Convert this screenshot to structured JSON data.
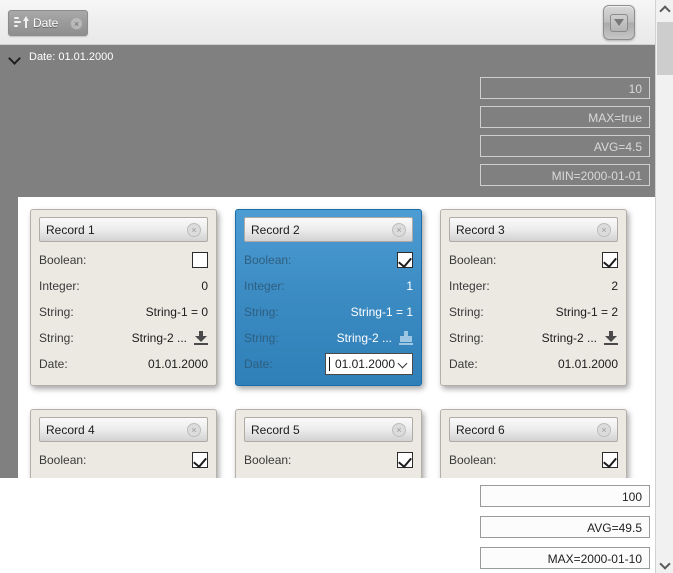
{
  "toolbar": {
    "sort_chip_label": "Date",
    "sort_chip_close": "×",
    "sort_icon": "sort-ascending-icon",
    "filter_button_icon": "filter-dropdown-icon"
  },
  "group": {
    "label": "Date: 01.01.2000",
    "expander_icon": "chevron-down-icon"
  },
  "aggregates_top": [
    {
      "value": "10"
    },
    {
      "value": "MAX=true"
    },
    {
      "value": "AVG=4.5"
    },
    {
      "value": "MIN=2000-01-01"
    }
  ],
  "aggregates_bottom": [
    {
      "value": "100"
    },
    {
      "value": "AVG=49.5"
    },
    {
      "value": "MAX=2000-01-10"
    }
  ],
  "field_labels": {
    "boolean": "Boolean:",
    "integer": "Integer:",
    "string1": "String:",
    "string2": "String:",
    "date": "Date:"
  },
  "cards": [
    {
      "title": "Record 1",
      "close": "×",
      "boolean": false,
      "integer": "0",
      "string1": "String-1 = 0",
      "string2": "String-2 ...",
      "date": "01.01.2000",
      "selected": false,
      "truncated": false
    },
    {
      "title": "Record 2",
      "close": "×",
      "boolean": true,
      "integer": "1",
      "string1": "String-1 = 1",
      "string2": "String-2 ...",
      "date": "01.01.2000",
      "selected": true,
      "truncated": false,
      "date_editing": true
    },
    {
      "title": "Record 3",
      "close": "×",
      "boolean": true,
      "integer": "2",
      "string1": "String-1 = 2",
      "string2": "String-2 ...",
      "date": "01.01.2000",
      "selected": false,
      "truncated": false
    },
    {
      "title": "Record 4",
      "close": "×",
      "boolean": true,
      "selected": false,
      "truncated": true
    },
    {
      "title": "Record 5",
      "close": "×",
      "boolean": true,
      "selected": false,
      "truncated": true
    },
    {
      "title": "Record 6",
      "close": "×",
      "boolean": true,
      "selected": false,
      "truncated": true
    }
  ],
  "colors": {
    "selection": "#3d8cc4",
    "group_band": "#808080",
    "card_bg": "#ece9e3"
  }
}
